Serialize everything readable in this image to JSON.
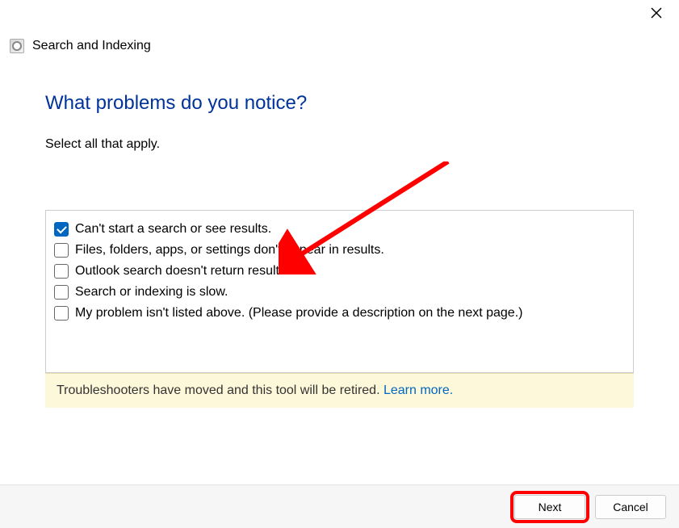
{
  "window": {
    "title": "Search and Indexing"
  },
  "page": {
    "title": "What problems do you notice?",
    "instruction": "Select all that apply."
  },
  "options": [
    {
      "label": "Can't start a search or see results.",
      "checked": true
    },
    {
      "label": "Files, folders, apps, or settings don't appear in results.",
      "checked": false
    },
    {
      "label": "Outlook search doesn't return results.",
      "checked": false
    },
    {
      "label": "Search or indexing is slow.",
      "checked": false
    },
    {
      "label": "My problem isn't listed above. (Please provide a description on the next page.)",
      "checked": false
    }
  ],
  "notice": {
    "text": "Troubleshooters have moved and this tool will be retired. ",
    "link": "Learn more."
  },
  "buttons": {
    "next": "Next",
    "cancel": "Cancel"
  }
}
